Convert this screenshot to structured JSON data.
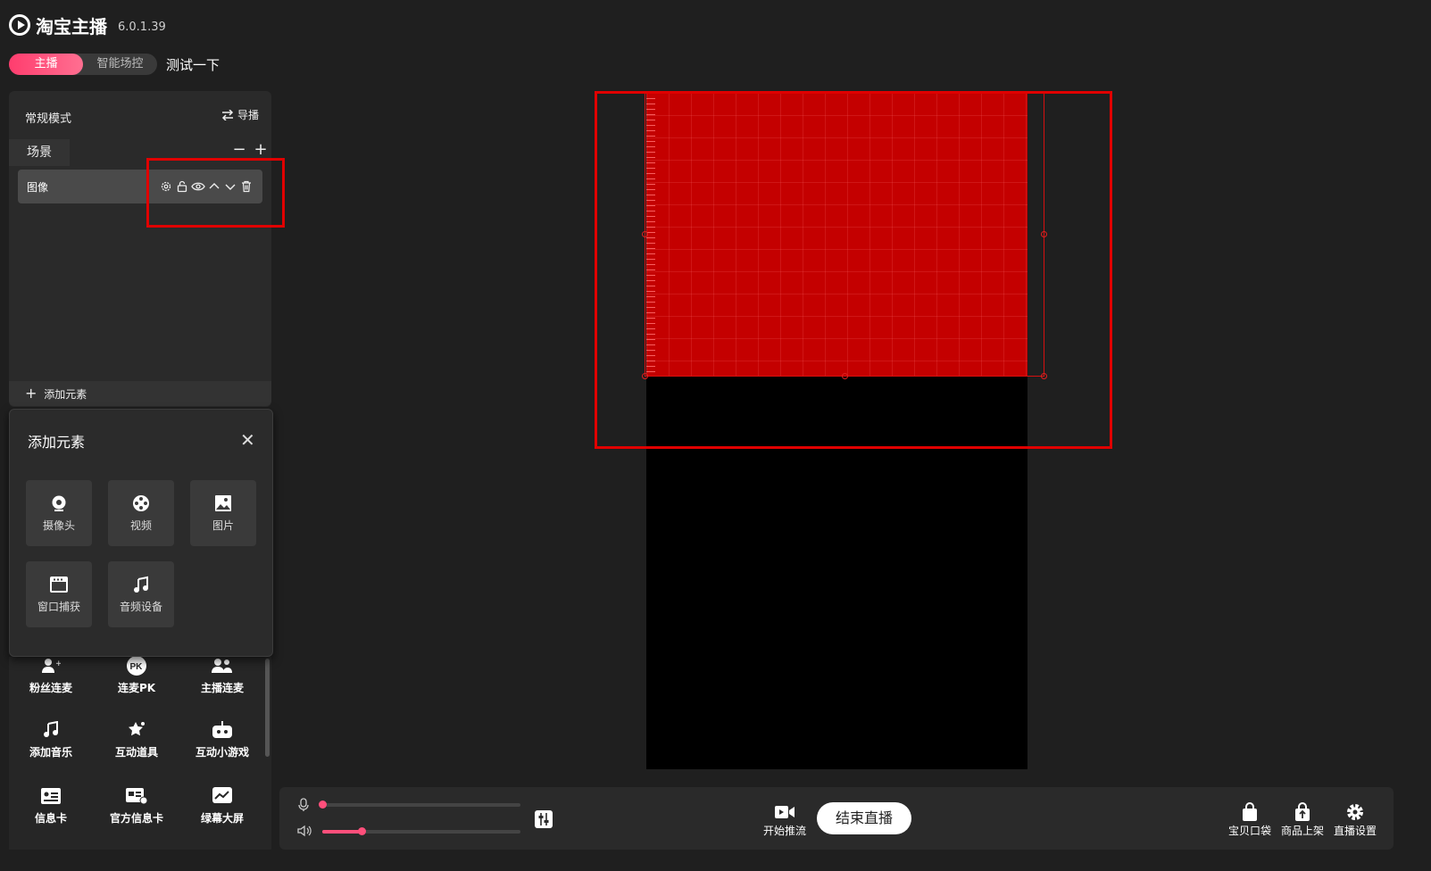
{
  "app": {
    "name": "淘宝主播",
    "version": "6.0.1.39"
  },
  "mode_tabs": [
    "主播",
    "智能场控"
  ],
  "room_title": "测试一下",
  "scene_panel": {
    "mode_label": "常规模式",
    "guide_label": "导播",
    "scene_tab": "场景",
    "minus": "−",
    "plus": "+",
    "layer_name": "图像",
    "add_element_label": "添加元素"
  },
  "add_popup": {
    "title": "添加元素",
    "close": "✕",
    "tiles": [
      {
        "label": "摄像头",
        "icon": "webcam-icon"
      },
      {
        "label": "视频",
        "icon": "film-reel-icon"
      },
      {
        "label": "图片",
        "icon": "image-icon"
      },
      {
        "label": "窗口捕获",
        "icon": "window-icon"
      },
      {
        "label": "音频设备",
        "icon": "music-note-icon"
      }
    ]
  },
  "tools": [
    {
      "label": "粉丝连麦",
      "icon": "fans-link-icon"
    },
    {
      "label": "连麦PK",
      "icon": "pk-icon"
    },
    {
      "label": "主播连麦",
      "icon": "anchor-link-icon"
    },
    {
      "label": "添加音乐",
      "icon": "music-icon"
    },
    {
      "label": "互动道具",
      "icon": "props-icon"
    },
    {
      "label": "互动小游戏",
      "icon": "game-icon"
    },
    {
      "label": "信息卡",
      "icon": "info-card-icon"
    },
    {
      "label": "官方信息卡",
      "icon": "official-card-icon"
    },
    {
      "label": "绿幕大屏",
      "icon": "green-screen-icon"
    }
  ],
  "audio": {
    "mic_level": 0.0,
    "speaker_level": 0.2
  },
  "bottom": {
    "push_label": "开始推流",
    "end_live_label": "结束直播",
    "right_buttons": [
      {
        "label": "宝贝口袋",
        "icon": "bag-icon"
      },
      {
        "label": "商品上架",
        "icon": "upload-bag-icon"
      },
      {
        "label": "直播设置",
        "icon": "gear-icon"
      }
    ]
  },
  "colors": {
    "accent": "#ff4f7b",
    "image_layer": "#c40000",
    "highlight": "#e00000"
  }
}
